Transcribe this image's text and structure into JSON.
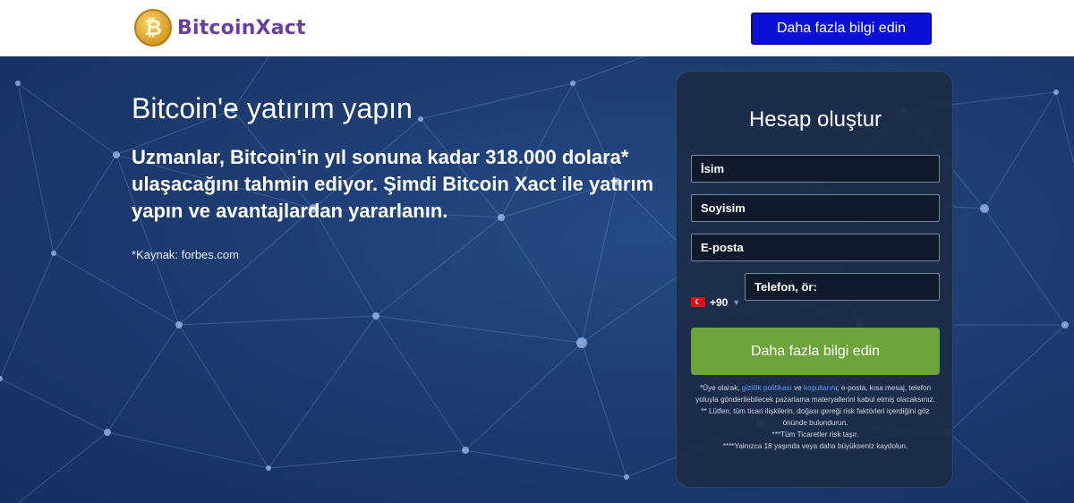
{
  "header": {
    "logo_symbol": "₿",
    "logo_text": "BitcoinXact",
    "cta_label": "Daha fazla bilgi edin",
    "colors": {
      "logo_text": "#6a3fa0",
      "cta_bg": "#0b10d6"
    }
  },
  "hero": {
    "headline": "Bitcoin'e yatırım yapın",
    "subtext": "Uzmanlar, Bitcoin'in yıl sonuna kadar 318.000 dolara* ulaşacağını tahmin ediyor. Şimdi Bitcoin Xact ile yatırım yapın ve avantajlardan yararlanın.",
    "source": "*Kaynak: forbes.com"
  },
  "form": {
    "title": "Hesap oluştur",
    "first_name_placeholder": "İsim",
    "last_name_placeholder": "Soyisim",
    "email_placeholder": "E-posta",
    "phone_country_code": "+90",
    "phone_flag_icon": "turkey-flag-icon",
    "phone_placeholder": "Telefon, ör:",
    "submit_label": "Daha fazla bilgi edin",
    "submit_color": "#6ca33b",
    "disclaimer": {
      "line1_pre": "*Üye olarak, ",
      "privacy_link": "gizlilik politikası",
      "line1_mid": " ve ",
      "terms_link": "koşulların",
      "line1_post": "ı; e-posta, kısa mesaj, telefon yoluyla gönderilebilecek pazarlama materyallerini kabul etmiş olacaksınız.",
      "line2": "** Lütfen, tüm ticari ilişkilerin, doğası gereği risk faktörleri içerdiğini göz önünde bulundurun.",
      "line3": "***Tüm Ticaretler risk taşır.",
      "line4": "****Yalnızca 18 yaşında veya daha büyükseniz kaydolun."
    }
  },
  "colors": {
    "hero_bg": "#1c3a6e",
    "card_bg": "#1c2c48"
  }
}
